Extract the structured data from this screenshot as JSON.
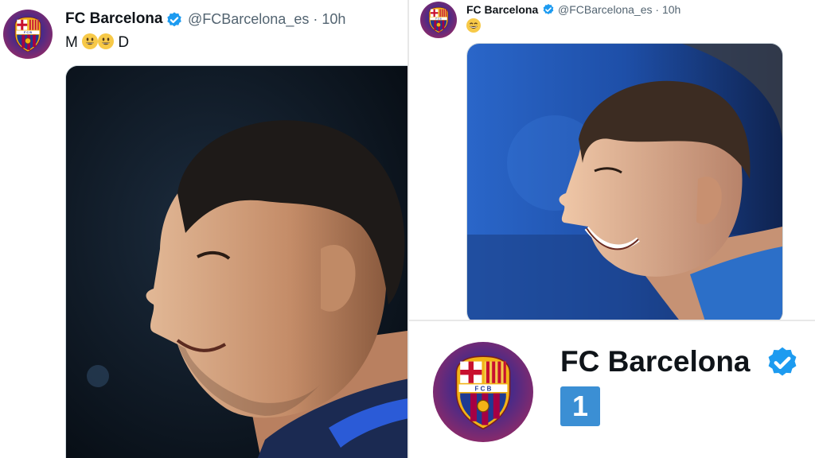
{
  "tweet_left": {
    "account_name": "FC Barcelona",
    "handle": "@FCBarcelona_es",
    "separator": "·",
    "time": "10h",
    "text_start": "M",
    "text_end": "D",
    "emoji": [
      "grinning-face-emoji",
      "grinning-face-emoji"
    ],
    "image": "photo of smiling man in navy training top"
  },
  "tweet_right": {
    "account_name": "FC Barcelona",
    "handle": "@FCBarcelona_es",
    "separator": "·",
    "time": "10h",
    "emoji": [
      "beaming-face-emoji"
    ],
    "image": "photo of smiling man in blue, profile view"
  },
  "profile_zoom": {
    "account_name": "FC Barcelona",
    "badge_number": "1"
  },
  "crest": {
    "letters": "FCB"
  },
  "colors": {
    "verified": "#1d9bf0",
    "handle": "#536471",
    "barca_blue": "#1f3a93",
    "barca_red": "#b3123b",
    "gold": "#f2b316"
  }
}
